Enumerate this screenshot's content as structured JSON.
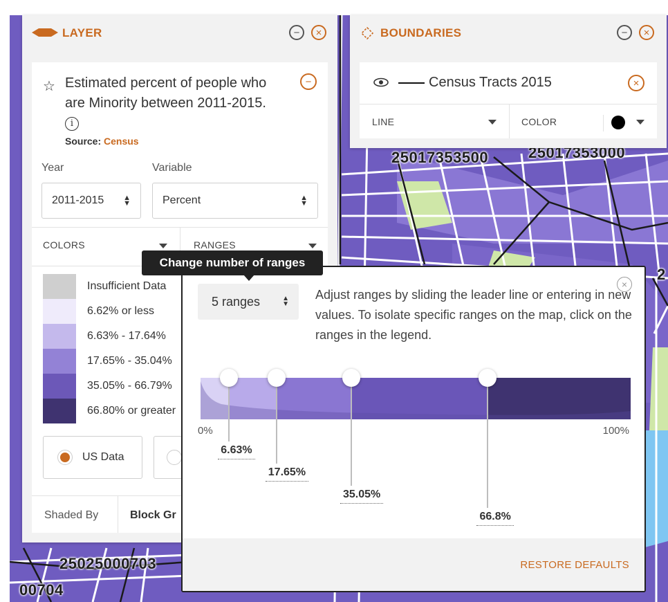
{
  "map": {
    "tract_labels": [
      "25017353500",
      "25017353000",
      "25025000703",
      "00704",
      "2"
    ],
    "colors": {
      "fill": "#6f5cc0",
      "fill_dark": "#4a3a8a",
      "street": "#ffffff",
      "boundary": "#1a1a1a",
      "park": "#cfe7a8",
      "water": "#7fc6f2"
    }
  },
  "layer_panel": {
    "title": "LAYER",
    "icon": "layer-icon",
    "dataset": {
      "title": "Estimated percent of people who are Minority between 2011-2015.",
      "source_label": "Source:",
      "source_value": "Census"
    },
    "year": {
      "label": "Year",
      "value": "2011-2015"
    },
    "variable": {
      "label": "Variable",
      "value": "Percent"
    },
    "colors_label": "COLORS",
    "ranges_label": "RANGES",
    "legend": [
      {
        "label": "Insufficient Data",
        "color": "#cfcfcf"
      },
      {
        "label": "6.62% or less",
        "color": "#efebfb"
      },
      {
        "label": "6.63% - 17.64%",
        "color": "#c4b9ec"
      },
      {
        "label": "17.65% - 35.04%",
        "color": "#9382d6"
      },
      {
        "label": "35.05% - 66.79%",
        "color": "#6c58b8"
      },
      {
        "label": "66.80% or greater",
        "color": "#3f3370"
      }
    ],
    "data_option": "US Data",
    "shaded_by_label": "Shaded By",
    "shaded_by_value": "Block Gr"
  },
  "boundaries_panel": {
    "title": "BOUNDARIES",
    "icon": "boundary-icon",
    "item": "Census Tracts 2015",
    "line_label": "LINE",
    "color_label": "COLOR",
    "line_color": "#000000"
  },
  "ranges_popup": {
    "tooltip": "Change number of ranges",
    "count_value": "5 ranges",
    "instructions": "Adjust ranges by sliding the leader line or entering in new values. To isolate specific ranges on the map, click on the ranges in the legend.",
    "axis_min": "0%",
    "axis_max": "100%",
    "breakpoints": [
      {
        "label": "6.63%",
        "value": 6.63
      },
      {
        "label": "17.65%",
        "value": 17.65
      },
      {
        "label": "35.05%",
        "value": 35.05
      },
      {
        "label": "66.8%",
        "value": 66.8
      }
    ],
    "band_colors": [
      "#d9d2f5",
      "#b8aaea",
      "#8a76d2",
      "#6a56b8",
      "#3f3370"
    ],
    "restore_label": "RESTORE DEFAULTS"
  }
}
